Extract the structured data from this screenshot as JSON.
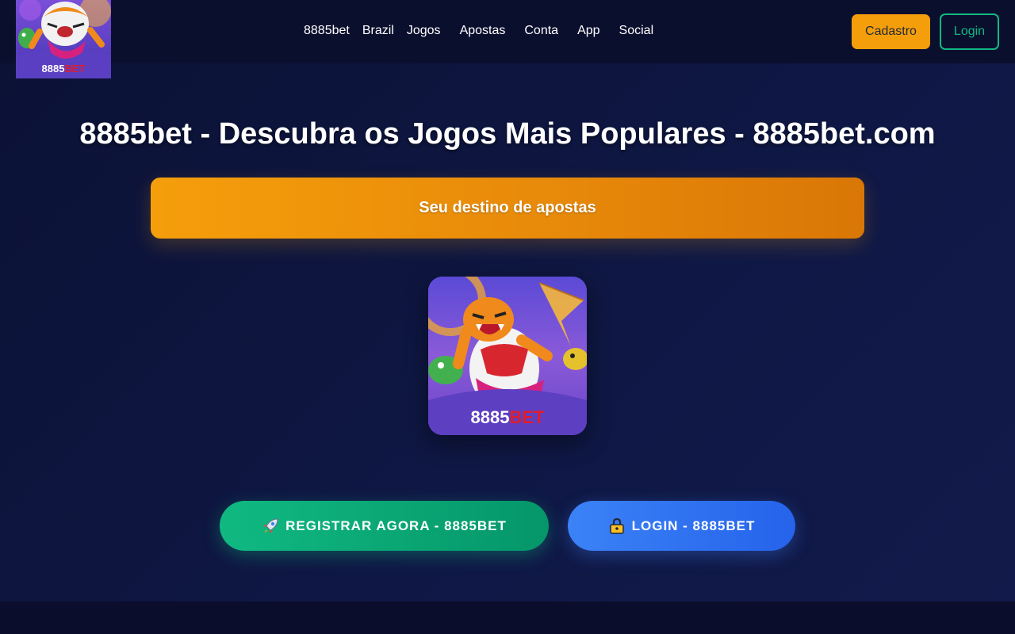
{
  "header": {
    "logo": {
      "text_primary": "8885",
      "text_accent": "BET"
    },
    "nav": [
      {
        "label": "8885bet"
      },
      {
        "label": "Brazil"
      },
      {
        "label": "Jogos"
      },
      {
        "label": "Apostas"
      },
      {
        "label": "Conta"
      },
      {
        "label": "App"
      },
      {
        "label": "Social"
      }
    ],
    "cadastro_label": "Cadastro",
    "login_label": "Login"
  },
  "main": {
    "title": "8885bet - Descubra os Jogos Mais Populares - 8885bet.com",
    "banner_text": "Seu destino de apostas",
    "app_image": {
      "text_primary": "8885",
      "text_accent": "BET"
    },
    "cta_register": {
      "icon": "rocket-icon",
      "label": "REGISTRAR AGORA - 8885BET"
    },
    "cta_login": {
      "icon": "lock-icon",
      "label": "LOGIN - 8885BET"
    }
  },
  "colors": {
    "background": "#0b1030",
    "header": "#0b0f2e",
    "accent_orange": "#f59e0b",
    "accent_green": "#10b981",
    "accent_blue": "#3b82f6",
    "logo_red": "#e11d2a"
  }
}
